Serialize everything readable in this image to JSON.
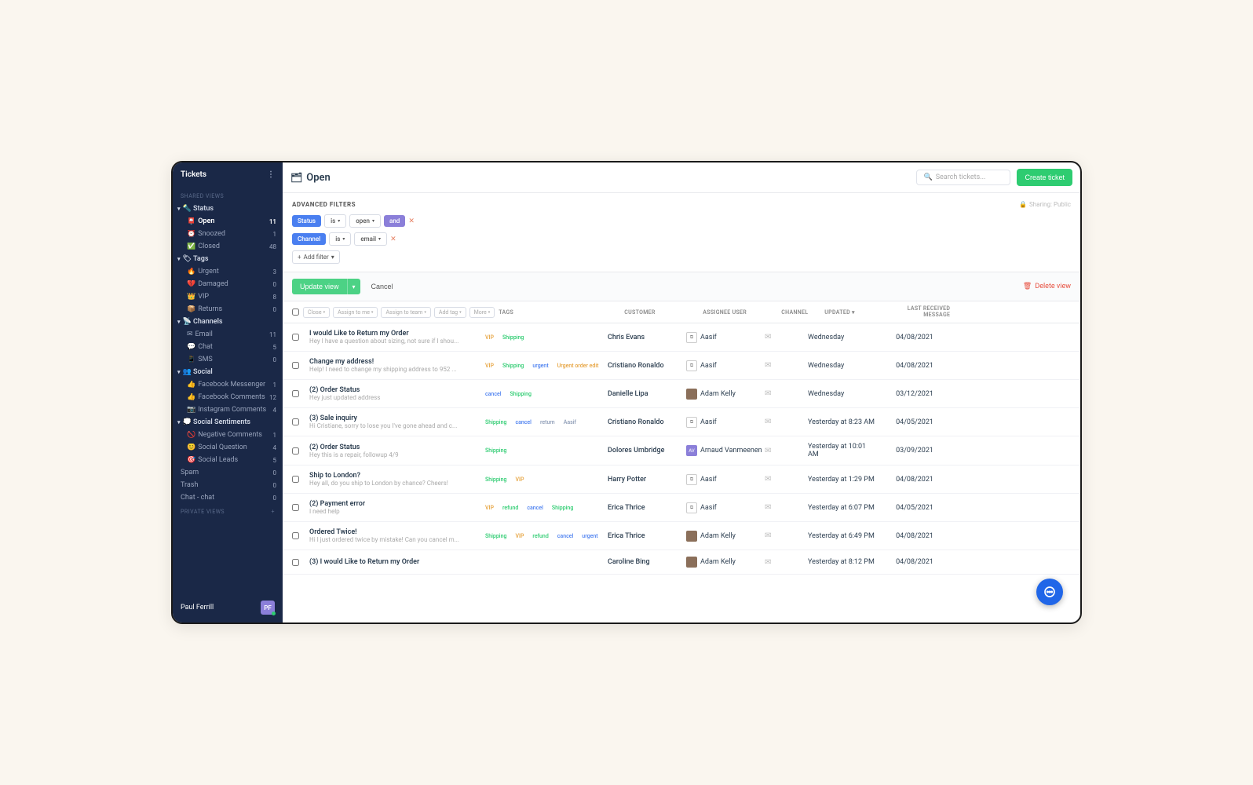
{
  "sidebar": {
    "title": "Tickets",
    "sharedViewsLabel": "SHARED VIEWS",
    "privateViewsLabel": "PRIVATE VIEWS",
    "groups": [
      {
        "icon": "🔦",
        "label": "Status",
        "items": [
          {
            "icon": "📮",
            "label": "Open",
            "count": "11",
            "active": true
          },
          {
            "icon": "⏰",
            "label": "Snoozed",
            "count": "1"
          },
          {
            "icon": "✅",
            "label": "Closed",
            "count": "48"
          }
        ]
      },
      {
        "icon": "🏷",
        "label": "Tags",
        "items": [
          {
            "icon": "🔥",
            "label": "Urgent",
            "count": "3"
          },
          {
            "icon": "💔",
            "label": "Damaged",
            "count": "0"
          },
          {
            "icon": "👑",
            "label": "VIP",
            "count": "8"
          },
          {
            "icon": "📦",
            "label": "Returns",
            "count": "0"
          }
        ]
      },
      {
        "icon": "📡",
        "label": "Channels",
        "items": [
          {
            "icon": "✉",
            "label": "Email",
            "count": "11"
          },
          {
            "icon": "💬",
            "label": "Chat",
            "count": "5"
          },
          {
            "icon": "📱",
            "label": "SMS",
            "count": "0"
          }
        ]
      },
      {
        "icon": "👥",
        "label": "Social",
        "items": [
          {
            "icon": "👍",
            "label": "Facebook Messenger",
            "count": "1"
          },
          {
            "icon": "👍",
            "label": "Facebook Comments",
            "count": "12"
          },
          {
            "icon": "📷",
            "label": "Instagram Comments",
            "count": "4"
          }
        ]
      },
      {
        "icon": "💭",
        "label": "Social Sentiments",
        "items": [
          {
            "icon": "🚫",
            "label": "Negative Comments",
            "count": "1"
          },
          {
            "icon": "😊",
            "label": "Social Question",
            "count": "4"
          },
          {
            "icon": "🎯",
            "label": "Social Leads",
            "count": "5"
          }
        ]
      }
    ],
    "flatItems": [
      {
        "label": "Spam",
        "count": "0"
      },
      {
        "label": "Trash",
        "count": "0"
      },
      {
        "label": "Chat - chat",
        "count": "0"
      }
    ],
    "user": {
      "name": "Paul Ferrill",
      "initials": "PF"
    }
  },
  "topbar": {
    "title": "Open",
    "searchPlaceholder": "Search tickets...",
    "createLabel": "Create ticket"
  },
  "filters": {
    "title": "ADVANCED FILTERS",
    "sharing": "Sharing: Public",
    "rows": [
      {
        "field": "Status",
        "operator": "is",
        "value": "open",
        "conj": "and"
      },
      {
        "field": "Channel",
        "operator": "is",
        "value": "email"
      }
    ],
    "addFilter": "Add filter"
  },
  "actions": {
    "update": "Update view",
    "cancel": "Cancel",
    "delete": "Delete view"
  },
  "bulkActions": [
    "Close",
    "Assign to me",
    "Assign to team",
    "Add tag",
    "More"
  ],
  "columns": {
    "tags": "TAGS",
    "customer": "CUSTOMER",
    "assignee": "ASSIGNEE USER",
    "channel": "CHANNEL",
    "updated": "UPDATED",
    "last": "LAST RECEIVED MESSAGE"
  },
  "tickets": [
    {
      "subject": "I would Like to Return my Order",
      "preview": "Hey I have a question about sizing, not sure if I shou...",
      "tags": [
        {
          "t": "VIP",
          "c": "tag-vip"
        },
        {
          "t": "Shipping",
          "c": "tag-shipping"
        }
      ],
      "customer": "Chris Evans",
      "assignee": "Aasif",
      "avatar": "icon",
      "updated": "Wednesday",
      "date": "04/08/2021"
    },
    {
      "subject": "Change my address!",
      "preview": "Help! I need to change my shipping address to 952 ...",
      "tags": [
        {
          "t": "VIP",
          "c": "tag-vip"
        },
        {
          "t": "Shipping",
          "c": "tag-shipping"
        },
        {
          "t": "urgent",
          "c": "tag-urgent"
        },
        {
          "t": "Urgent order edit",
          "c": "tag-orange"
        }
      ],
      "customer": "Cristiano Ronaldo",
      "assignee": "Aasif",
      "avatar": "icon",
      "updated": "Wednesday",
      "date": "04/08/2021"
    },
    {
      "subject": "(2) Order Status",
      "preview": "Hey just updated address",
      "tags": [
        {
          "t": "cancel",
          "c": "tag-cancel"
        },
        {
          "t": "Shipping",
          "c": "tag-shipping"
        }
      ],
      "customer": "Danielle Lipa",
      "assignee": "Adam Kelly",
      "avatar": "photo",
      "updated": "Wednesday",
      "date": "03/12/2021"
    },
    {
      "subject": "(3) Sale inquiry",
      "preview": "Hi Cristiane, sorry to lose you I've gone ahead and c...",
      "tags": [
        {
          "t": "Shipping",
          "c": "tag-shipping"
        },
        {
          "t": "cancel",
          "c": "tag-cancel"
        },
        {
          "t": "return",
          "c": "tag-return"
        },
        {
          "t": "Aasif",
          "c": "tag-aasif"
        }
      ],
      "customer": "Cristiano Ronaldo",
      "assignee": "Aasif",
      "avatar": "icon",
      "updated": "Yesterday at 8:23 AM",
      "date": "04/05/2021"
    },
    {
      "subject": "(2) Order Status",
      "preview": "Hey this is a repair, followup 4/9",
      "tags": [
        {
          "t": "Shipping",
          "c": "tag-shipping"
        }
      ],
      "customer": "Dolores Umbridge",
      "assignee": "Arnaud Vanmeenen",
      "avatar": "av",
      "updated": "Yesterday at 10:01 AM",
      "date": "03/09/2021"
    },
    {
      "subject": "Ship to London?",
      "preview": "Hey all, do you ship to London by chance? Cheers!",
      "tags": [
        {
          "t": "Shipping",
          "c": "tag-shipping"
        },
        {
          "t": "VIP",
          "c": "tag-vip"
        }
      ],
      "customer": "Harry Potter",
      "assignee": "Aasif",
      "avatar": "icon",
      "updated": "Yesterday at 1:29 PM",
      "date": "04/08/2021"
    },
    {
      "subject": "(2) Payment error",
      "preview": "I need help",
      "tags": [
        {
          "t": "VIP",
          "c": "tag-vip"
        },
        {
          "t": "refund",
          "c": "tag-refund"
        },
        {
          "t": "cancel",
          "c": "tag-cancel"
        },
        {
          "t": "Shipping",
          "c": "tag-shipping"
        }
      ],
      "customer": "Erica Thrice",
      "assignee": "Aasif",
      "avatar": "icon",
      "updated": "Yesterday at 6:07 PM",
      "date": "04/05/2021"
    },
    {
      "subject": "Ordered Twice!",
      "preview": "Hi I just ordered twice by mistake! Can you cancel m...",
      "tags": [
        {
          "t": "Shipping",
          "c": "tag-shipping"
        },
        {
          "t": "VIP",
          "c": "tag-vip"
        },
        {
          "t": "refund",
          "c": "tag-refund"
        },
        {
          "t": "cancel",
          "c": "tag-cancel"
        },
        {
          "t": "urgent",
          "c": "tag-urgent"
        }
      ],
      "customer": "Erica Thrice",
      "assignee": "Adam Kelly",
      "avatar": "photo",
      "updated": "Yesterday at 6:49 PM",
      "date": "04/08/2021"
    },
    {
      "subject": "(3) I would Like to Return my Order",
      "preview": "",
      "tags": [],
      "customer": "Caroline Bing",
      "assignee": "Adam Kelly",
      "avatar": "photo",
      "updated": "Yesterday at 8:12 PM",
      "date": "04/08/2021"
    }
  ]
}
